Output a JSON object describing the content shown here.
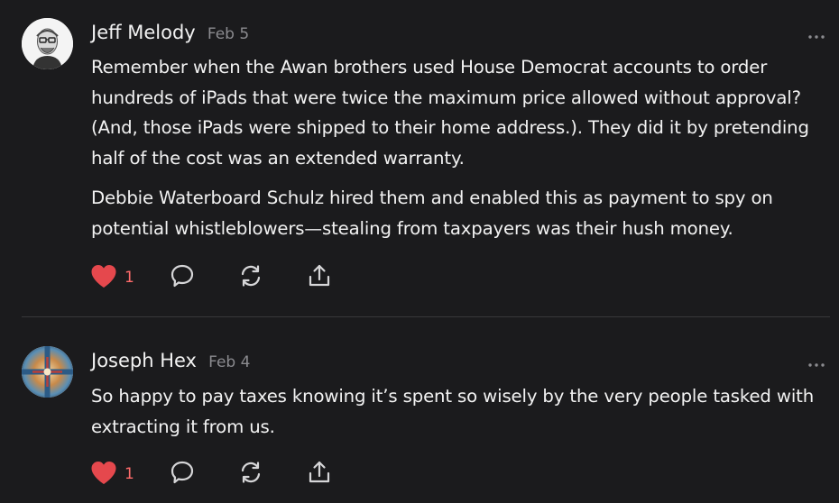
{
  "comments": [
    {
      "author": "Jeff Melody",
      "date": "Feb 5",
      "paragraphs": [
        "Remember when the Awan brothers used House Democrat accounts to order hundreds of iPads that were twice the maximum price allowed without approval? (And, those iPads were shipped to their home address.). They did it by pretending half of the cost was an extended warranty.",
        "Debbie Waterboard Schulz hired them and enabled this as payment to spy on potential whistleblowers—stealing from taxpayers was their hush money."
      ],
      "likes": "1",
      "icons": [
        "more-icon",
        "heart-icon",
        "comment-icon",
        "restack-icon",
        "share-icon"
      ],
      "like_color": "#e5484d"
    },
    {
      "author": "Joseph Hex",
      "date": "Feb 4",
      "paragraphs": [
        "So happy to pay taxes knowing it’s spent so wisely by the very people tasked with extracting it from us."
      ],
      "likes": "1",
      "icons": [
        "more-icon",
        "heart-icon",
        "comment-icon",
        "restack-icon",
        "share-icon"
      ],
      "like_color": "#e5484d"
    }
  ]
}
